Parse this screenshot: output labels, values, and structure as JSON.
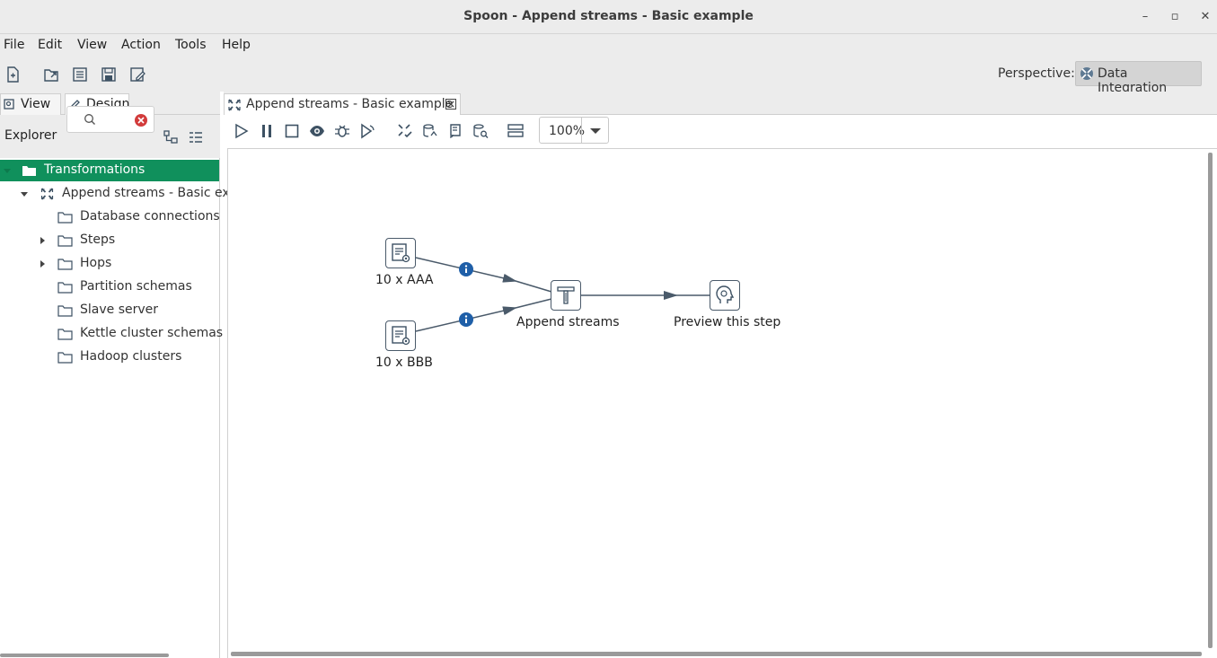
{
  "window": {
    "title": "Spoon - Append streams - Basic example",
    "minimize": "–",
    "restore": "▫",
    "close": "✕"
  },
  "menu": [
    "File",
    "Edit",
    "View",
    "Action",
    "Tools",
    "Help"
  ],
  "toolbar": {
    "perspective_label": "Perspective:",
    "perspective_value": "Data Integration"
  },
  "left_panel": {
    "tabs": {
      "view": "View",
      "design": "Design"
    },
    "explorer_label": "Explorer",
    "tree": [
      {
        "label": "Transformations",
        "selected": true
      },
      {
        "label": "Append streams - Basic ex"
      },
      {
        "label": "Database connections"
      },
      {
        "label": "Steps"
      },
      {
        "label": "Hops"
      },
      {
        "label": "Partition schemas"
      },
      {
        "label": "Slave server"
      },
      {
        "label": "Kettle cluster schemas"
      },
      {
        "label": "Hadoop clusters"
      }
    ]
  },
  "editor": {
    "tab_label": "Append streams - Basic example",
    "zoom": "100%"
  },
  "diagram": {
    "steps": [
      {
        "id": "aaa",
        "label": "10 x AAA"
      },
      {
        "id": "bbb",
        "label": "10 x BBB"
      },
      {
        "id": "append",
        "label": "Append streams"
      },
      {
        "id": "preview",
        "label": "Preview this step"
      }
    ]
  },
  "colors": {
    "selection": "#10905c",
    "hop": "#4a5a6a",
    "info_badge": "#1f5fa8"
  }
}
